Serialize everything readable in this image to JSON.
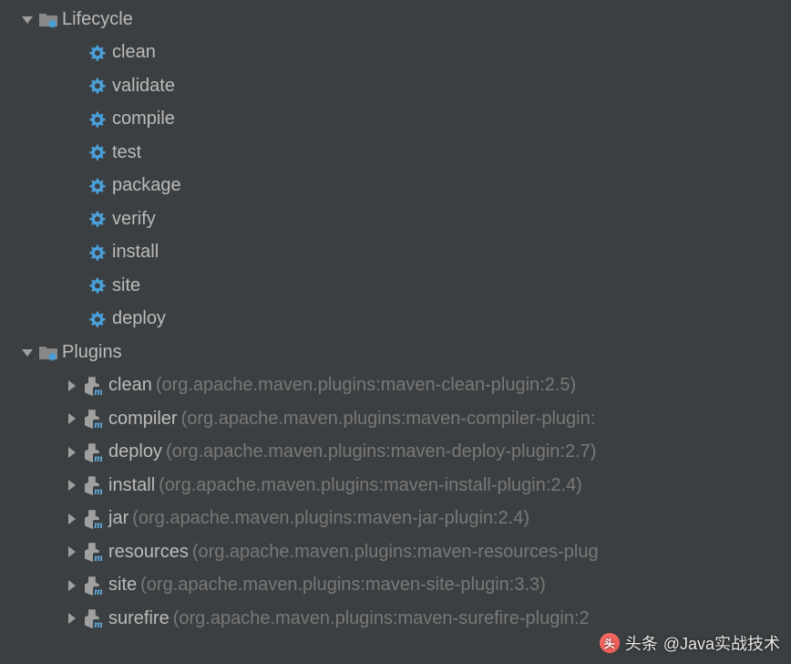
{
  "tree": {
    "lifecycle": {
      "label": "Lifecycle",
      "phases": [
        "clean",
        "validate",
        "compile",
        "test",
        "package",
        "verify",
        "install",
        "site",
        "deploy"
      ]
    },
    "plugins": {
      "label": "Plugins",
      "items": [
        {
          "name": "clean",
          "coords": "(org.apache.maven.plugins:maven-clean-plugin:2.5)"
        },
        {
          "name": "compiler",
          "coords": "(org.apache.maven.plugins:maven-compiler-plugin:"
        },
        {
          "name": "deploy",
          "coords": "(org.apache.maven.plugins:maven-deploy-plugin:2.7)"
        },
        {
          "name": "install",
          "coords": "(org.apache.maven.plugins:maven-install-plugin:2.4)"
        },
        {
          "name": "jar",
          "coords": "(org.apache.maven.plugins:maven-jar-plugin:2.4)"
        },
        {
          "name": "resources",
          "coords": "(org.apache.maven.plugins:maven-resources-plug"
        },
        {
          "name": "site",
          "coords": "(org.apache.maven.plugins:maven-site-plugin:3.3)"
        },
        {
          "name": "surefire",
          "coords": "(org.apache.maven.plugins:maven-surefire-plugin:2"
        }
      ]
    }
  },
  "watermark": {
    "prefix": "头条",
    "handle": "@Java实战技术"
  }
}
